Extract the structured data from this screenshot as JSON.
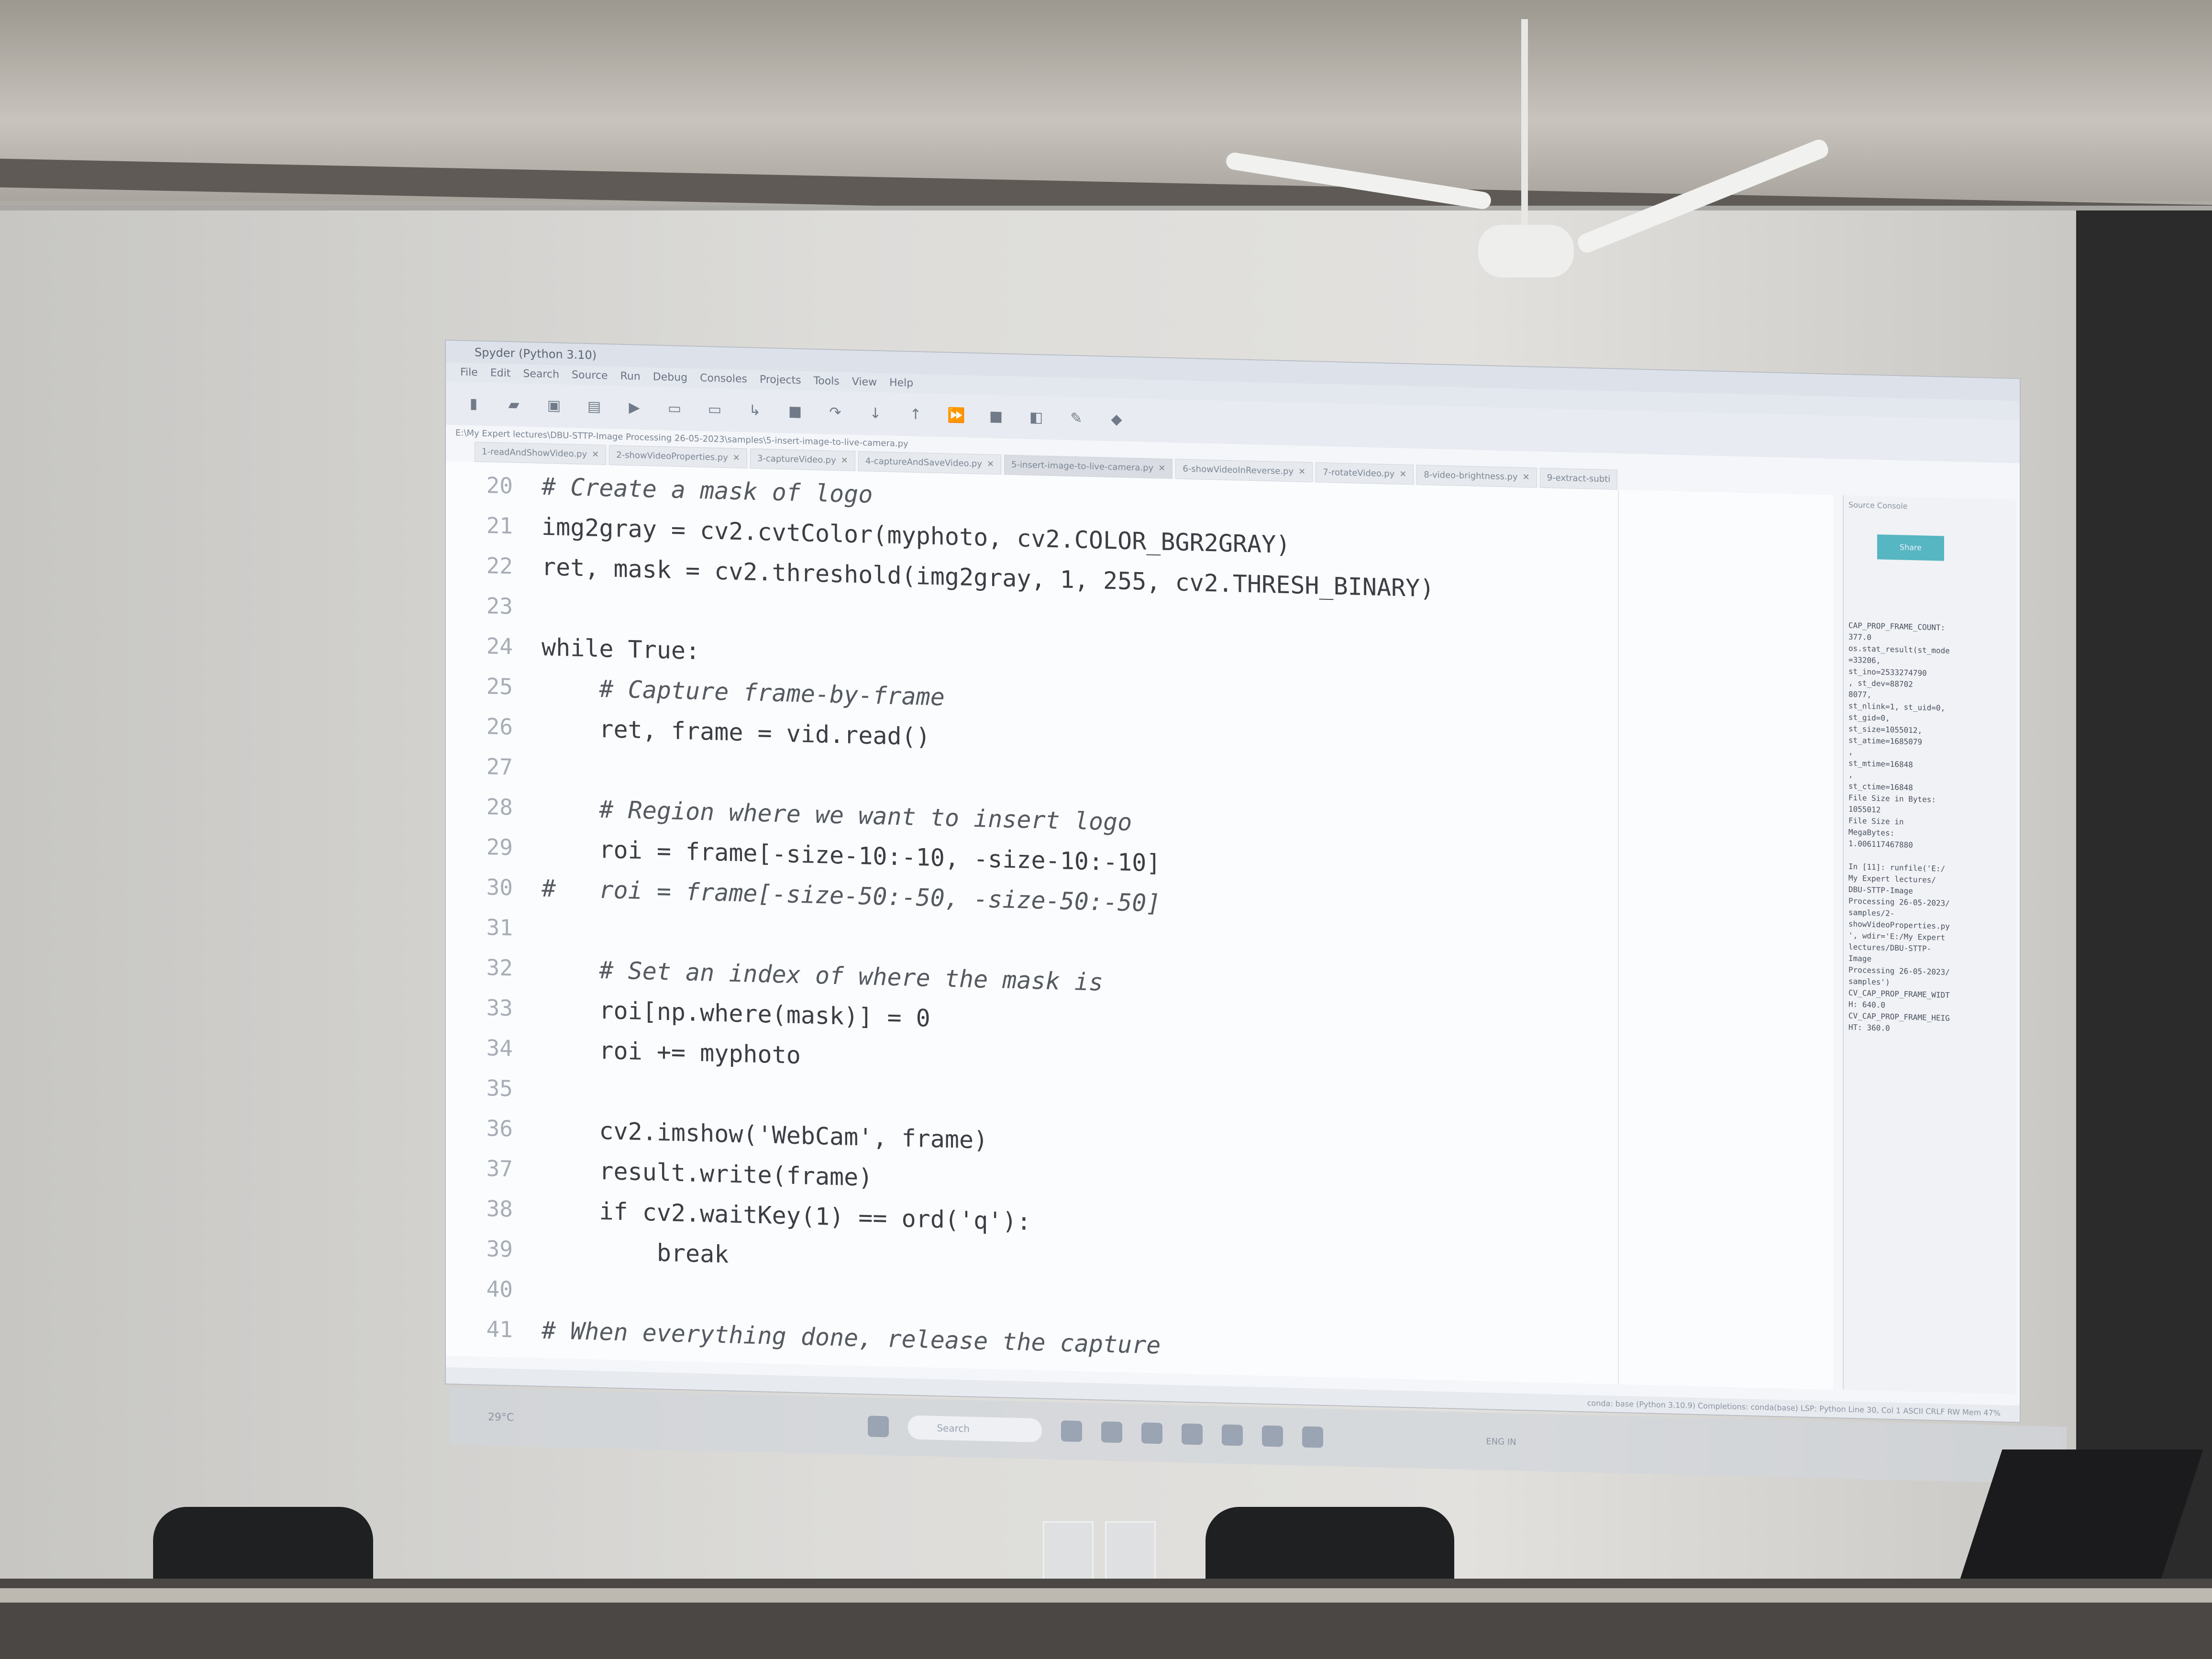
{
  "window": {
    "title": "Spyder (Python 3.10)",
    "menu": [
      "File",
      "Edit",
      "Search",
      "Source",
      "Run",
      "Debug",
      "Consoles",
      "Projects",
      "Tools",
      "View",
      "Help"
    ],
    "path": "E:\\My Expert lectures\\DBU-STTP-Image Processing 26-05-2023\\samples\\5-insert-image-to-live-camera.py",
    "status": "conda: base (Python 3.10.9)   Completions: conda(base)   LSP: Python   Line 30, Col 1   ASCII   CRLF   RW   Mem 47%"
  },
  "tabs": [
    {
      "label": "1-readAndShowVideo.py"
    },
    {
      "label": "2-showVideoProperties.py"
    },
    {
      "label": "3-captureVideo.py"
    },
    {
      "label": "4-captureAndSaveVideo.py"
    },
    {
      "label": "5-insert-image-to-live-camera.py",
      "active": true
    },
    {
      "label": "6-showVideoInReverse.py"
    },
    {
      "label": "7-rotateVideo.py"
    },
    {
      "label": "8-video-brightness.py"
    },
    {
      "label": "9-extract-subti"
    }
  ],
  "code": [
    {
      "n": "20",
      "text": "# Create a mask of logo",
      "comment": true
    },
    {
      "n": "21",
      "text": "img2gray = cv2.cvtColor(myphoto, cv2.COLOR_BGR2GRAY)"
    },
    {
      "n": "22",
      "text": "ret, mask = cv2.threshold(img2gray, 1, 255, cv2.THRESH_BINARY)"
    },
    {
      "n": "23",
      "text": ""
    },
    {
      "n": "24",
      "text": "while True:"
    },
    {
      "n": "25",
      "text": "    # Capture frame-by-frame",
      "comment": true
    },
    {
      "n": "26",
      "text": "    ret, frame = vid.read()"
    },
    {
      "n": "27",
      "text": ""
    },
    {
      "n": "28",
      "text": "    # Region where we want to insert logo",
      "comment": true
    },
    {
      "n": "29",
      "text": "    roi = frame[-size-10:-10, -size-10:-10]"
    },
    {
      "n": "30",
      "text": "#   roi = frame[-size-50:-50, -size-50:-50]",
      "comment": true
    },
    {
      "n": "31",
      "text": ""
    },
    {
      "n": "32",
      "text": "    # Set an index of where the mask is",
      "comment": true
    },
    {
      "n": "33",
      "text": "    roi[np.where(mask)] = 0"
    },
    {
      "n": "34",
      "text": "    roi += myphoto"
    },
    {
      "n": "35",
      "text": ""
    },
    {
      "n": "36",
      "text": "    cv2.imshow('WebCam', frame)"
    },
    {
      "n": "37",
      "text": "    result.write(frame)"
    },
    {
      "n": "38",
      "text": "    if cv2.waitKey(1) == ord('q'):"
    },
    {
      "n": "39",
      "text": "        break"
    },
    {
      "n": "40",
      "text": ""
    },
    {
      "n": "41",
      "text": "# When everything done, release the capture",
      "comment": true
    }
  ],
  "side": {
    "header": "Source   Console",
    "button": "Share",
    "console": "CAP_PROP_FRAME_COUNT:\n377.0\nos.stat_result(st_mode\n=33206,\nst_ino=2533274790\n, st_dev=88702\n8077,\nst_nlink=1, st_uid=0,\nst_gid=0,\nst_size=1055012,\nst_atime=1685079\n,\nst_mtime=16848\n,\nst_ctime=16848\nFile Size in Bytes:\n1055012\nFile Size in\nMegaBytes:\n1.006117467880\n\nIn [11]: runfile('E:/\nMy Expert lectures/\nDBU-STTP-Image\nProcessing 26-05-2023/\nsamples/2-\nshowVideoProperties.py\n', wdir='E:/My Expert\nlectures/DBU-STTP-\nImage\nProcessing 26-05-2023/\nsamples')\nCV_CAP_PROP_FRAME_WIDT\nH: 640.0\nCV_CAP_PROP_FRAME_HEIG\nHT: 360.0"
  },
  "taskbar": {
    "weather": "29°C",
    "search_placeholder": "Search",
    "lang": "ENG IN"
  }
}
